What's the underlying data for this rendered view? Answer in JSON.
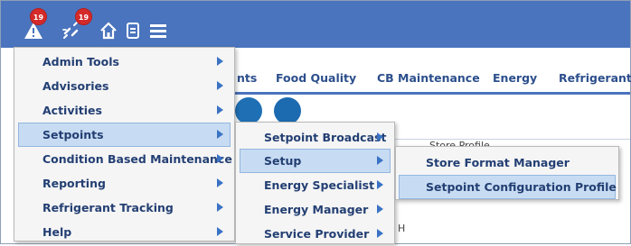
{
  "toolbar": {
    "alarm_count": "19",
    "link_count": "19",
    "icons": [
      "alarm-icon",
      "broken-link-icon",
      "home-icon",
      "document-icon",
      "hamburger-menu-icon"
    ],
    "accent_color": "#4a74bd",
    "badge_color": "#d42a2a"
  },
  "tabs": [
    "nts",
    "Food Quality",
    "CB Maintenance",
    "Energy",
    "Refrigerant"
  ],
  "background_text": {
    "profile_fragment": "Store Profile",
    "h_fragment": "H"
  },
  "main_menu": {
    "items": [
      {
        "label": "Admin Tools"
      },
      {
        "label": "Advisories"
      },
      {
        "label": "Activities"
      },
      {
        "label": "Setpoints"
      },
      {
        "label": "Condition Based Maintenance"
      },
      {
        "label": "Reporting"
      },
      {
        "label": "Refrigerant Tracking"
      },
      {
        "label": "Help"
      }
    ],
    "selected": "Setpoints"
  },
  "setpoints_menu": {
    "items": [
      {
        "label": "Setpoint Broadcast"
      },
      {
        "label": "Setup"
      },
      {
        "label": "Energy Specialist"
      },
      {
        "label": "Energy Manager"
      },
      {
        "label": "Service Provider"
      }
    ],
    "selected": "Setup"
  },
  "setup_menu": {
    "items": [
      {
        "label": "Store Format Manager"
      },
      {
        "label": "Setpoint Configuration Profile"
      }
    ],
    "selected": "Setpoint Configuration Profile"
  }
}
